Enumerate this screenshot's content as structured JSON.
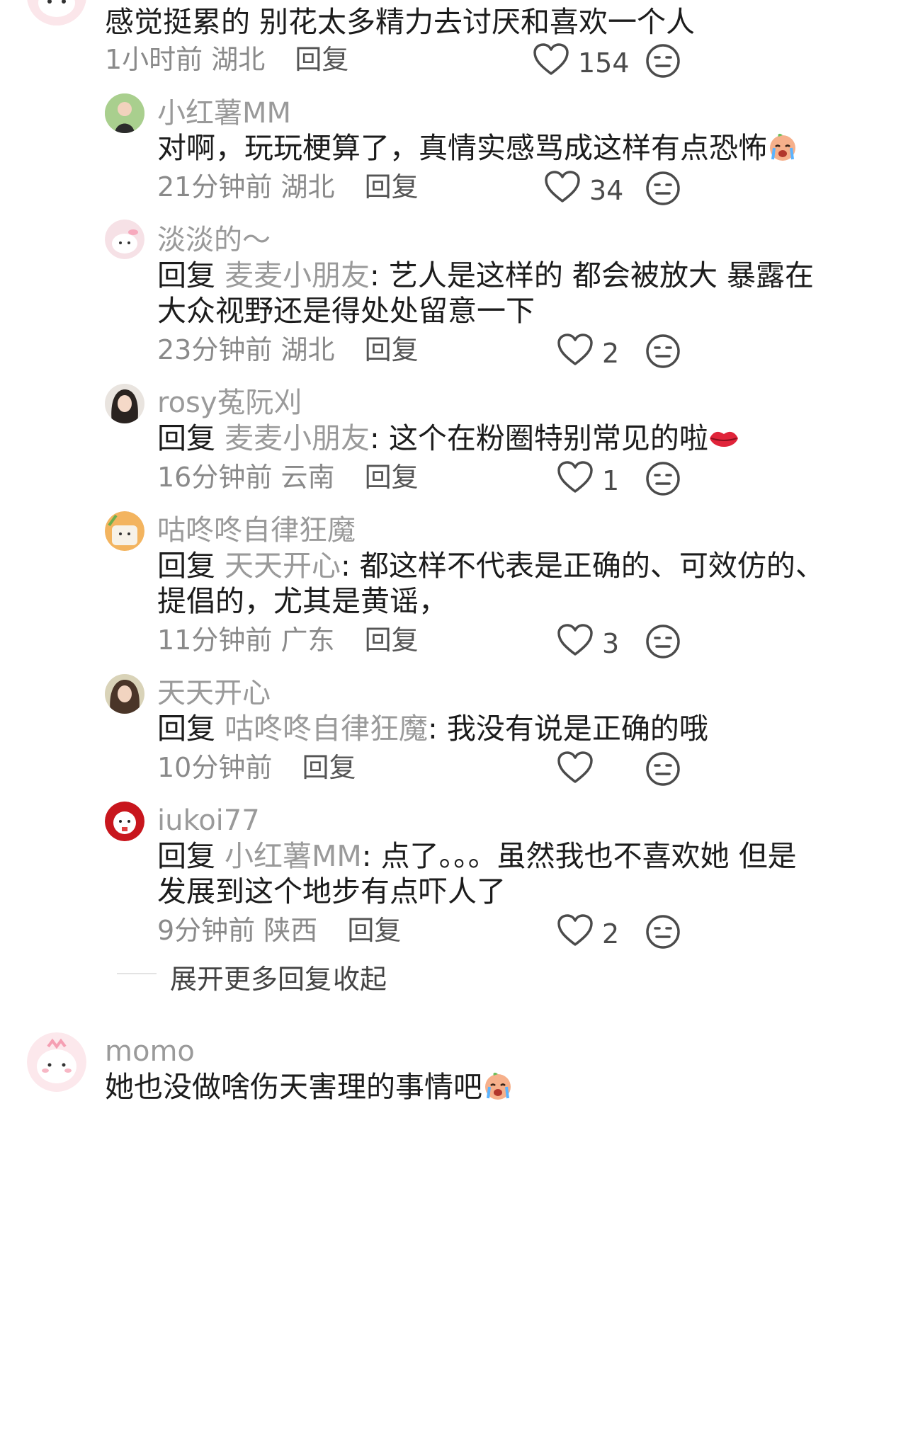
{
  "top_comment": {
    "text": "感觉挺累的 别花太多精力去讨厌和喜欢一个人",
    "time": "1小时前",
    "location": "湖北",
    "reply_label": "回复",
    "likes": "154"
  },
  "replies": [
    {
      "user": "小红薯MM",
      "prefix": "",
      "reply_to": "",
      "lines": [
        "对啊，玩玩梗算了，真情实感骂成这样有点恐怖"
      ],
      "time": "21分钟前",
      "location": "湖北",
      "likes": "34",
      "emoji": "crying-face"
    },
    {
      "user": "淡淡的～",
      "prefix": "回复",
      "reply_to": "麦麦小朋友",
      "lines": [
        "艺人是这样的 都会被放大 暴露在",
        "大众视野还是得处处留意一下"
      ],
      "time": "23分钟前",
      "location": "湖北",
      "likes": "2"
    },
    {
      "user": "rosy菟阮刈",
      "prefix": "回复",
      "reply_to": "麦麦小朋友",
      "lines": [
        "这个在粉圈特别常见的啦"
      ],
      "time": "16分钟前",
      "location": "云南",
      "likes": "1",
      "emoji": "lips"
    },
    {
      "user": "咕咚咚自律狂魔",
      "prefix": "回复",
      "reply_to": "天天开心",
      "lines": [
        "都这样不代表是正确的、可效仿的、",
        "提倡的，尤其是黄谣，"
      ],
      "time": "11分钟前",
      "location": "广东",
      "likes": "3"
    },
    {
      "user": "天天开心",
      "prefix": "回复",
      "reply_to": "咕咚咚自律狂魔",
      "lines": [
        "我没有说是正确的哦"
      ],
      "time": "10分钟前",
      "location": "",
      "likes": ""
    },
    {
      "user": "iukoi77",
      "prefix": "回复",
      "reply_to": "小红薯MM",
      "lines": [
        "点了。。。虽然我也不喜欢她 但是",
        "发展到这个地步有点吓人了"
      ],
      "time": "9分钟前",
      "location": "陕西",
      "likes": "2"
    }
  ],
  "reply_label": "回复",
  "expand_more": "展开更多回复",
  "collapse": "收起",
  "next_comment": {
    "user": "momo",
    "text": "她也没做啥伤天害理的事情吧",
    "emoji": "crying-face"
  },
  "colors": {
    "name_gray": "#9a9a9a",
    "text": "#1c1c1c",
    "meta_gray": "#8a8a8a"
  }
}
